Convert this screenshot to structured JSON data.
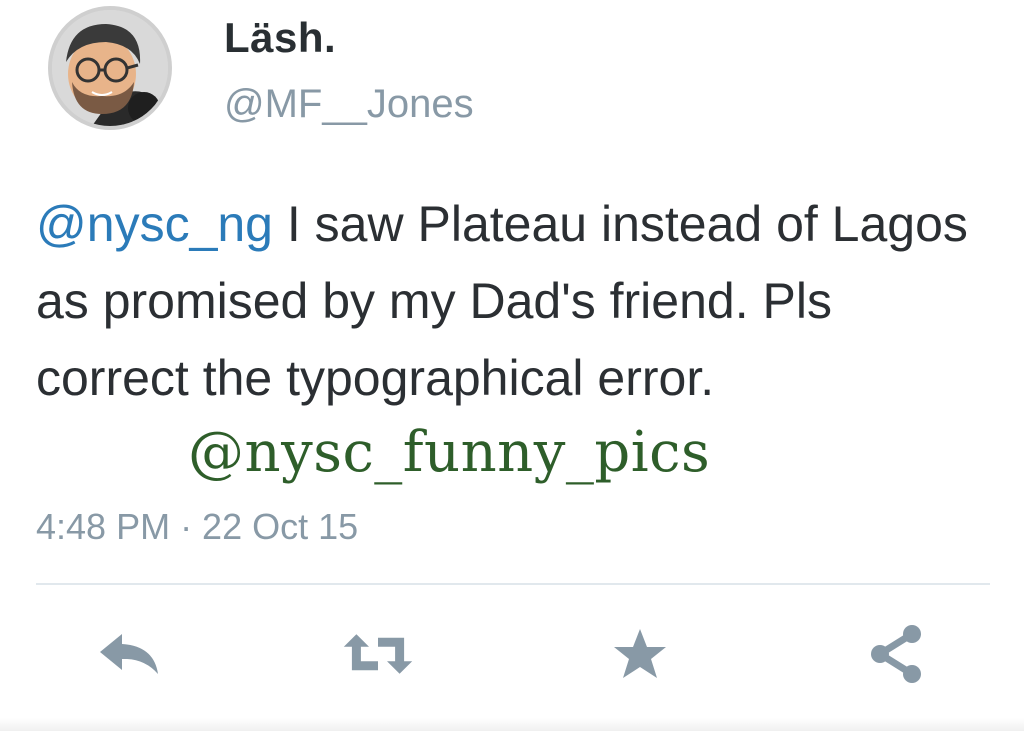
{
  "user": {
    "display_name": "Läsh.",
    "handle": "@MF__Jones"
  },
  "tweet": {
    "mention": "@nysc_ng",
    "text": " I saw Plateau instead of Lagos as promised by my Dad's friend. Pls correct the typographical error.",
    "watermark": "@nysc_funny_pics",
    "timestamp": "4:48 PM · 22 Oct 15"
  },
  "actions": [
    {
      "icon": "reply-icon"
    },
    {
      "icon": "retweet-icon"
    },
    {
      "icon": "favorite-star-icon"
    },
    {
      "icon": "share-icon"
    }
  ],
  "colors": {
    "mention": "#2b7bb9",
    "muted": "#8899a6",
    "action_icon": "#8899a6",
    "watermark": "#2e5e2a"
  }
}
